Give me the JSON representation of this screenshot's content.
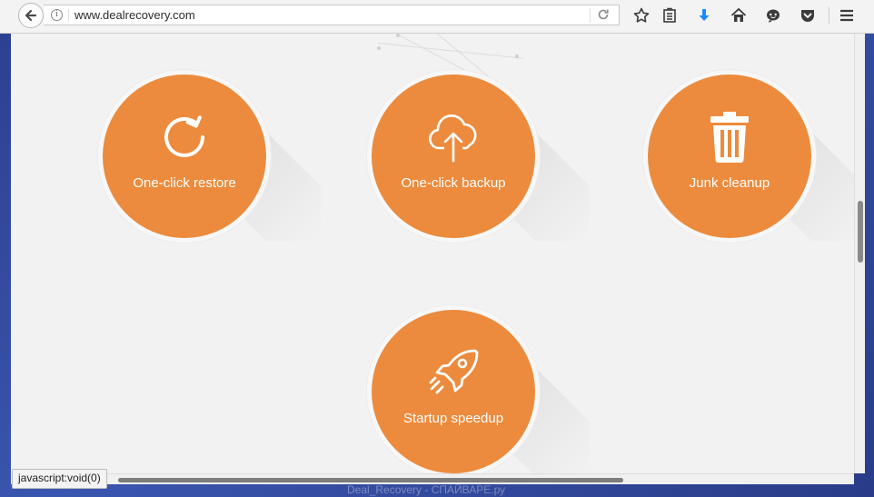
{
  "browser": {
    "url": "www.dealrecovery.com",
    "status_text": "javascript:void(0)"
  },
  "icons": {
    "back": "back-arrow-icon",
    "info": "info-icon",
    "reload": "reload-icon",
    "bookmark": "star-icon",
    "reading_list": "reading-list-icon",
    "download": "download-icon",
    "home": "home-icon",
    "chat": "chat-icon",
    "pocket": "pocket-icon",
    "menu": "hamburger-menu-icon"
  },
  "features": [
    {
      "label": "One-click restore",
      "icon": "restore-icon"
    },
    {
      "label": "One-click backup",
      "icon": "cloud-upload-icon"
    },
    {
      "label": "Junk cleanup",
      "icon": "trash-icon"
    },
    {
      "label": "Startup speedup",
      "icon": "rocket-icon"
    }
  ],
  "colors": {
    "accent": "#ec8b3d",
    "download_blue": "#1a8cff",
    "page_bg": "#f2f2f2"
  },
  "watermark": "Deal_Recovery - СПАЙВАРЕ.ру"
}
